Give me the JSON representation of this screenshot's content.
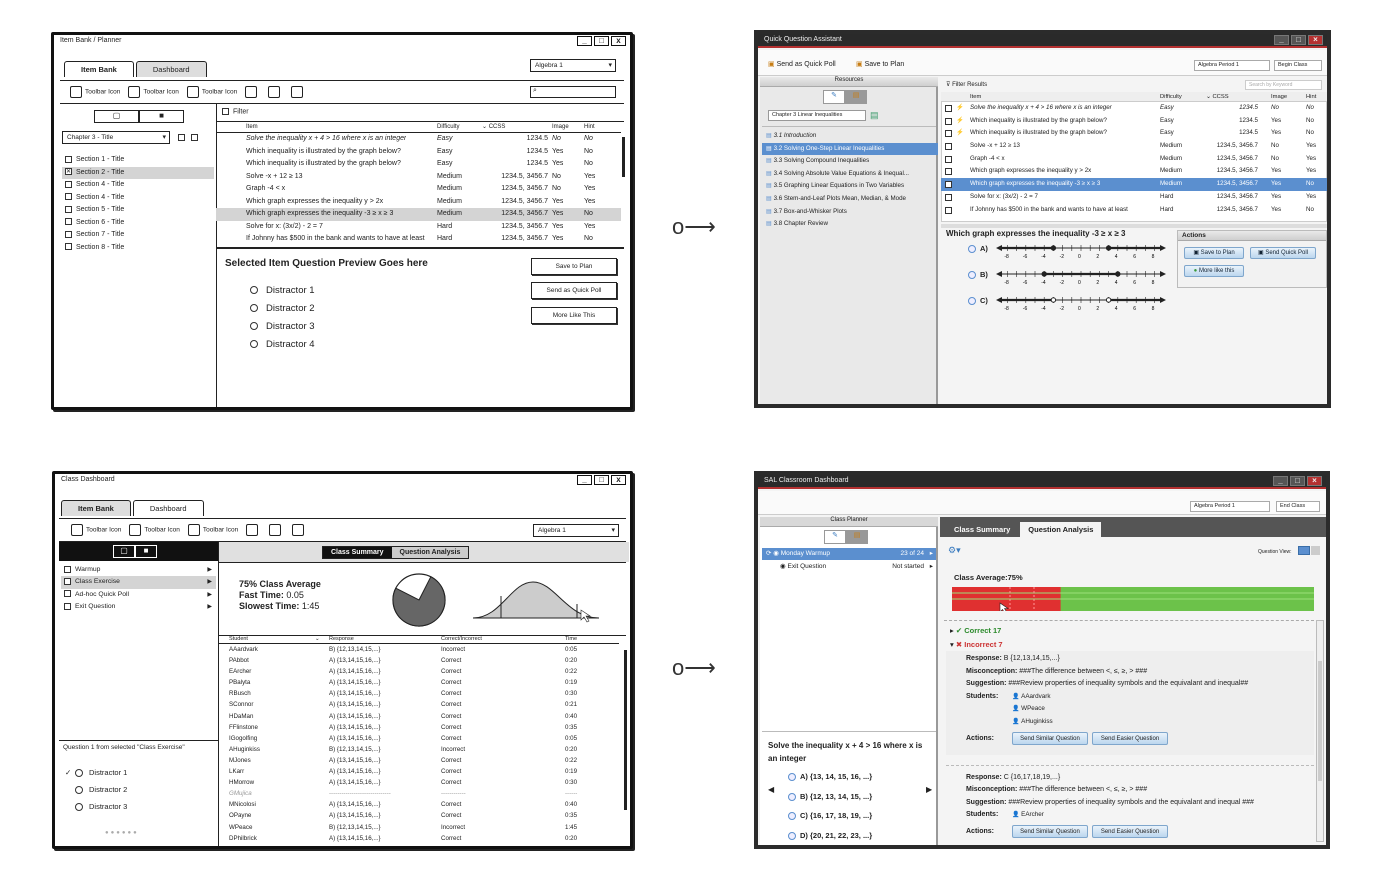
{
  "arrows": [
    "o⟶",
    "o⟶"
  ],
  "m1": {
    "title": "Item Bank / Planner",
    "winbtns": [
      "_",
      "□",
      "x"
    ],
    "tabs": [
      "Item Bank",
      "Dashboard"
    ],
    "toolbar": [
      "Toolbar Icon",
      "Toolbar Icon",
      "Toolbar Icon"
    ],
    "class_select": "Algebra 1",
    "chapter_select": "Chapter 3 - Title",
    "filter": "Filter",
    "sections": [
      "Section 1 - Title",
      "Section 2 - Title",
      "Section 4 - Title",
      "Section 4 - Title",
      "Section 5 - Title",
      "Section 6 - Title",
      "Section 7 - Title",
      "Section 8 - Title"
    ],
    "cols": [
      "Item",
      "Difficulty",
      "CCSS",
      "Image",
      "Hint"
    ],
    "rows": [
      [
        "Solve the inequality x + 4 > 16 where x is an integer",
        "Easy",
        "1234.5",
        "No",
        "No"
      ],
      [
        "Which inequality is illustrated by the graph below?",
        "Easy",
        "1234.5",
        "Yes",
        "No"
      ],
      [
        "Which inequality is illustrated by the graph below?",
        "Easy",
        "1234.5",
        "Yes",
        "No"
      ],
      [
        "Solve -x + 12 ≥ 13",
        "Medium",
        "1234.5, 3456.7",
        "No",
        "Yes"
      ],
      [
        "Graph -4 < x",
        "Medium",
        "1234.5, 3456.7",
        "No",
        "Yes"
      ],
      [
        "Which graph expresses the inequality y > 2x",
        "Medium",
        "1234.5, 3456.7",
        "Yes",
        "Yes"
      ],
      [
        "Which graph expresses the inequality -3 ≥ x ≥ 3",
        "Medium",
        "1234.5, 3456.7",
        "Yes",
        "No"
      ],
      [
        "Solve for x: (3x/2) - 2 = 7",
        "Hard",
        "1234.5, 3456.7",
        "Yes",
        "Yes"
      ],
      [
        "If Johnny has $500 in the bank and wants to have at least",
        "Hard",
        "1234.5, 3456.7",
        "Yes",
        "No"
      ]
    ],
    "preview_title": "Selected Item Question Preview Goes here",
    "distractors": [
      "Distractor 1",
      "Distractor 2",
      "Distractor 3",
      "Distractor 4"
    ],
    "buttons": [
      "Save to Plan",
      "Send as Quick Poll",
      "More Like This"
    ]
  },
  "m2": {
    "title": "Quick Question Assistant",
    "tb": [
      "Send as Quick Poll",
      "Save to Plan"
    ],
    "period": "Algebra Period 1",
    "begin": "Begin Class",
    "resources": "Resources",
    "filter_results": "Filter Results",
    "search_placeholder": "Search by Keyword",
    "chapter": "Chapter 3 Linear Inequalities",
    "lessons": [
      "3.1 Introduction",
      "3.2 Solving One-Step Linear Inequalities",
      "3.3 Solving Compound Inequalities",
      "3.4 Solving Absolute Value Equations & Inequal...",
      "3.5 Graphing Linear Equations in Two Variables",
      "3.6 Stem-and-Leaf Plots Mean, Median, & Mode",
      "3.7 Box-and-Whisker Plots",
      "3.8 Chapter Review"
    ],
    "cols": [
      "Item",
      "Difficulty",
      "CCSS",
      "Image",
      "Hint"
    ],
    "rows": [
      [
        "Solve the inequality x + 4 > 16 where x is an integer",
        "Easy",
        "1234.5",
        "No",
        "No"
      ],
      [
        "Which inequality is illustrated by the graph below?",
        "Easy",
        "1234.5",
        "Yes",
        "No"
      ],
      [
        "Which inequality is illustrated by the graph below?",
        "Easy",
        "1234.5",
        "Yes",
        "No"
      ],
      [
        "Solve -x + 12 ≥ 13",
        "Medium",
        "1234.5, 3456.7",
        "No",
        "Yes"
      ],
      [
        "Graph -4 < x",
        "Medium",
        "1234.5, 3456.7",
        "No",
        "Yes"
      ],
      [
        "Which graph expresses the inequality y > 2x",
        "Medium",
        "1234.5, 3456.7",
        "Yes",
        "Yes"
      ],
      [
        "Which graph expresses the inequality -3 ≥ x ≥ 3",
        "Medium",
        "1234.5, 3456.7",
        "Yes",
        "No"
      ],
      [
        "Solve for x: (3x/2) - 2 = 7",
        "Hard",
        "1234.5, 3456.7",
        "Yes",
        "Yes"
      ],
      [
        "If Johnny has $500 in the bank and wants to have at least",
        "Hard",
        "1234.5, 3456.7",
        "Yes",
        "No"
      ]
    ],
    "question": "Which graph expresses the inequality -3 ≥ x ≥ 3",
    "options": [
      "A)",
      "B)",
      "C)"
    ],
    "ticks": [
      "-8",
      "-6",
      "-4",
      "-2",
      "0",
      "2",
      "4",
      "6",
      "8"
    ],
    "actions_title": "Actions",
    "actions": [
      "Save to Plan",
      "Send Quick Poll",
      "More like this"
    ]
  },
  "m3": {
    "title": "Class Dashboard",
    "winbtns": [
      "_",
      "□",
      "x"
    ],
    "tabs": [
      "Item Bank",
      "Dashboard"
    ],
    "toolbar": [
      "Toolbar Icon",
      "Toolbar Icon",
      "Toolbar Icon"
    ],
    "class_select": "Algebra 1",
    "left_items": [
      "Warmup",
      "Class Exercise",
      "Ad-hoc Quick Poll",
      "Exit Question"
    ],
    "seg": [
      "Class Summary",
      "Question Analysis"
    ],
    "summary": {
      "avg": "75% Class Average",
      "fast_label": "Fast Time:",
      "fast": "0.05",
      "slow_label": "Slowest Time:",
      "slow": "1:45"
    },
    "cols": [
      "Student",
      "Response",
      "Correct/Incorrect",
      "Time"
    ],
    "rows": [
      [
        "AAardvark",
        "B) {12,13,14,15,...}",
        "Incorrect",
        "0:05"
      ],
      [
        "PAbbot",
        "A) {13,14,15,16,...}",
        "Correct",
        "0:20"
      ],
      [
        "EArcher",
        "A) {13,14,15,16,...}",
        "Correct",
        "0:22"
      ],
      [
        "PBalyta",
        "A) {13,14,15,16,...}",
        "Correct",
        "0:19"
      ],
      [
        "RBusch",
        "A) {13,14,15,16,...}",
        "Correct",
        "0:30"
      ],
      [
        "SConnor",
        "A) {13,14,15,16,...}",
        "Correct",
        "0:21"
      ],
      [
        "HDaMan",
        "A) {13,14,15,16,...}",
        "Correct",
        "0:40"
      ],
      [
        "FFlinstone",
        "A) {13,14,15,16,...}",
        "Correct",
        "0:35"
      ],
      [
        "IGogolfing",
        "A) {13,14,15,16,...}",
        "Correct",
        "0:05"
      ],
      [
        "AHuginkiss",
        "B) {12,13,14,15,...}",
        "Incorrect",
        "0:20"
      ],
      [
        "MJones",
        "A) {13,14,15,16,...}",
        "Correct",
        "0:22"
      ],
      [
        "LKarr",
        "A) {13,14,15,16,...}",
        "Correct",
        "0:19"
      ],
      [
        "HMorrow",
        "A) {13,14,15,16,...}",
        "Correct",
        "0:30"
      ],
      [
        "GMujica",
        "------------------------------",
        "------------",
        "------"
      ],
      [
        "MNicolosi",
        "A) {13,14,15,16,...}",
        "Correct",
        "0:40"
      ],
      [
        "OPayne",
        "A) {13,14,15,16,...}",
        "Correct",
        "0:35"
      ],
      [
        "WPeace",
        "B) {12,13,14,15,...}",
        "Incorrect",
        "1:45"
      ],
      [
        "DPhilbrick",
        "A) {13,14,15,16,...}",
        "Correct",
        "0:20"
      ]
    ],
    "question_label": "Question 1 from selected \"Class Exercise\"",
    "distractors": [
      "Distractor 1",
      "Distractor 2",
      "Distractor 3"
    ],
    "check": "✓",
    "dots": "●●●●●●",
    "pie_correct": 0.75
  },
  "m4": {
    "title": "SAL Classroom Dashboard",
    "period": "Algebra Period 1",
    "end": "End Class",
    "planner": "Class Planner",
    "plan_items": [
      {
        "name": "Monday Warmup",
        "status": "23 of 24"
      },
      {
        "name": "Exit Question",
        "status": "Not started"
      }
    ],
    "tabs": [
      "Class Summary",
      "Question Analysis"
    ],
    "qview": "Question View:",
    "class_avg": "Class Average:75%",
    "correct_pct": 0.75,
    "correct": "Correct 17",
    "incorrect": "Incorrect 7",
    "responses": [
      {
        "response_label": "Response:",
        "response": "B {12,13,14,15,...}",
        "misc_label": "Misconception:",
        "misconception": "###The difference between <, ≤, ≥, > ###",
        "sugg_label": "Suggestion:",
        "suggestion": "###Review properties of inequality symbols and the equivalant and inequal##",
        "students_label": "Students:",
        "students": [
          "AAardvark",
          "WPeace",
          "AHuginkiss"
        ],
        "actions_label": "Actions:",
        "actions": [
          "Send Similar Question",
          "Send Easier Question"
        ]
      },
      {
        "response_label": "Response:",
        "response": "C {16,17,18,19,...}",
        "misc_label": "Misconception:",
        "misconception": "###The difference between <, ≤, ≥, > ###",
        "sugg_label": "Suggestion:",
        "suggestion": "###Review properties of inequality symbols and the equivalant and inequal ###",
        "students_label": "Students:",
        "students": [
          "EArcher"
        ],
        "actions_label": "Actions:",
        "actions": [
          "Send Similar Question",
          "Send Easier Question"
        ]
      }
    ],
    "question": "Solve the inequality x + 4 > 16 where x is an integer",
    "options": [
      "A) {13, 14, 15, 16, ...}",
      "B) {12, 13, 14, 15, ...}",
      "C) {16, 17, 18, 19, ...}",
      "D) {20, 21, 22, 23, ...}"
    ]
  }
}
